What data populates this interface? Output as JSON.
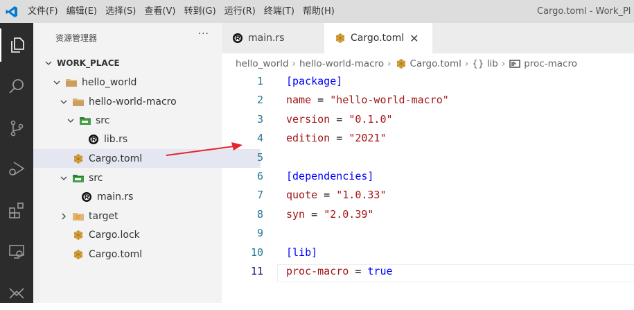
{
  "menu": [
    "文件(F)",
    "编辑(E)",
    "选择(S)",
    "查看(V)",
    "转到(G)",
    "运行(R)",
    "终端(T)",
    "帮助(H)"
  ],
  "window_title": "Cargo.toml - Work_Pl",
  "explorer": {
    "title": "资源管理器",
    "more": "···",
    "root": "WORK_PLACE",
    "items": [
      {
        "label": "hello_world"
      },
      {
        "label": "hello-world-macro"
      },
      {
        "label": "src"
      },
      {
        "label": "lib.rs"
      },
      {
        "label": "Cargo.toml"
      },
      {
        "label": "src"
      },
      {
        "label": "main.rs"
      },
      {
        "label": "target"
      },
      {
        "label": "Cargo.lock"
      },
      {
        "label": "Cargo.toml"
      }
    ]
  },
  "tabs": [
    {
      "label": "main.rs"
    },
    {
      "label": "Cargo.toml",
      "close": "✕"
    }
  ],
  "breadcrumb": [
    "hello_world",
    "hello-world-macro",
    "Cargo.toml",
    "{} lib",
    "proc-macro"
  ],
  "breadcrumb_sep": "›",
  "code": {
    "line_numbers": [
      "1",
      "2",
      "3",
      "4",
      "5",
      "6",
      "7",
      "8",
      "9",
      "10",
      "11"
    ],
    "lines": [
      [
        {
          "t": "[package]",
          "c": "#0000ff"
        }
      ],
      [
        {
          "t": "name",
          "c": "#a31515"
        },
        {
          "t": " = ",
          "c": "#000000"
        },
        {
          "t": "\"hello-world-macro\"",
          "c": "#a31515"
        }
      ],
      [
        {
          "t": "version",
          "c": "#a31515"
        },
        {
          "t": " = ",
          "c": "#000000"
        },
        {
          "t": "\"0.1.0\"",
          "c": "#a31515"
        }
      ],
      [
        {
          "t": "edition",
          "c": "#a31515"
        },
        {
          "t": " = ",
          "c": "#000000"
        },
        {
          "t": "\"2021\"",
          "c": "#a31515"
        }
      ],
      [],
      [
        {
          "t": "[dependencies]",
          "c": "#0000ff"
        }
      ],
      [
        {
          "t": "quote",
          "c": "#a31515"
        },
        {
          "t": " = ",
          "c": "#000000"
        },
        {
          "t": "\"1.0.33\"",
          "c": "#a31515"
        }
      ],
      [
        {
          "t": "syn",
          "c": "#a31515"
        },
        {
          "t": " = ",
          "c": "#000000"
        },
        {
          "t": "\"2.0.39\"",
          "c": "#a31515"
        }
      ],
      [],
      [
        {
          "t": "[lib]",
          "c": "#0000ff"
        }
      ],
      [
        {
          "t": "proc-macro",
          "c": "#a31515"
        },
        {
          "t": " = ",
          "c": "#000000"
        },
        {
          "t": "true",
          "c": "#0000ff"
        }
      ]
    ]
  },
  "colors": {
    "accent_blue": "#0078d4",
    "folder": "#dcb67a",
    "src_folder": "#2e7d32",
    "cargo_icon": "#d9a441",
    "annotation_arrow": "#e8232a"
  }
}
